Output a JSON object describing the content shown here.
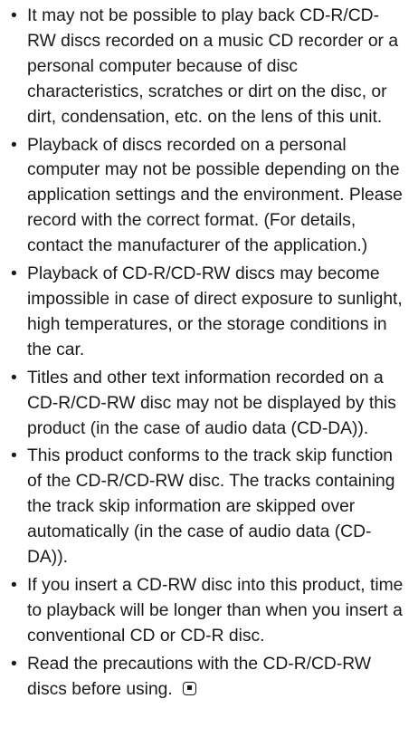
{
  "document": {
    "bullet_symbol": "•",
    "end_mark_icon": "end-of-section-icon",
    "items": [
      {
        "text": "It may not be possible to play back CD-R/CD-RW discs recorded on a music CD recorder or a personal computer because of disc characteristics, scratches or dirt on the disc, or dirt, condensation, etc. on the lens of this unit."
      },
      {
        "text": "Playback of discs recorded on a personal computer may not be possible depending on the application settings and the environment. Please record with the correct format. (For details, contact the manufacturer of the application.)"
      },
      {
        "text": "Playback of CD-R/CD-RW discs may become impossible in case of direct exposure to sunlight, high temperatures, or the storage conditions in the car."
      },
      {
        "text": "Titles and other text information recorded on a CD-R/CD-RW disc may not be displayed by this product (in the case of audio data (CD-DA))."
      },
      {
        "text": "This product conforms to the track skip function of the CD-R/CD-RW disc. The tracks containing the track skip information are skipped over automatically (in the case of audio data (CD-DA))."
      },
      {
        "text": "If you insert a CD-RW disc into this product, time to playback will be longer than when you insert a conventional CD or CD-R disc."
      },
      {
        "text": "Read the precautions with the CD-R/CD-RW discs before using."
      }
    ]
  }
}
